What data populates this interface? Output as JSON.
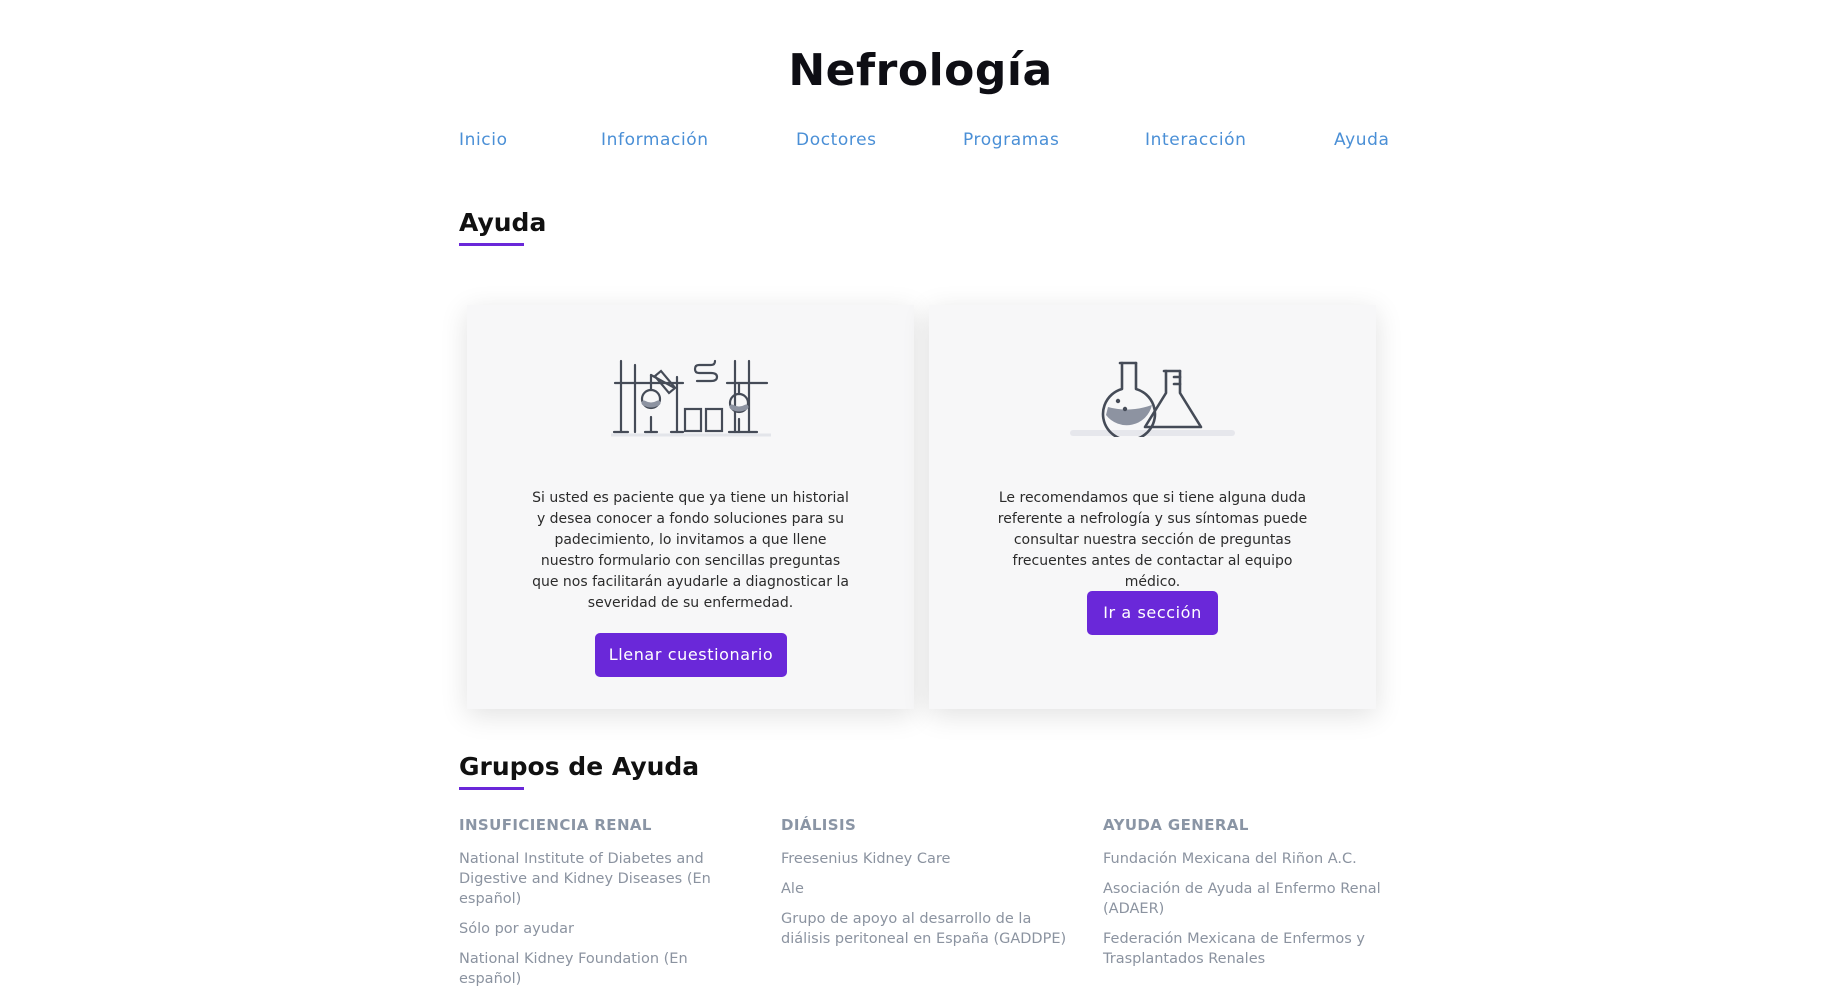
{
  "site": {
    "title": "Nefrología"
  },
  "nav": [
    "Inicio",
    "Información",
    "Doctores",
    "Programas",
    "Interacción",
    "Ayuda"
  ],
  "help": {
    "title": "Ayuda",
    "cards": [
      {
        "text": "Si usted es paciente que ya tiene un historial y desea conocer a fondo soluciones para su padecimiento, lo invitamos a que llene nuestro formulario con sencillas preguntas que nos facilitarán ayudarle a diagnosticar la severidad de su enfermedad.",
        "button": "Llenar cuestionario",
        "icon": "lab-equipment-icon"
      },
      {
        "text": "Le recomendamos que si tiene alguna duda referente a nefrología y sus síntomas puede consultar nuestra sección de preguntas frecuentes antes de contactar al equipo médico.",
        "button": "Ir a sección",
        "icon": "flasks-icon"
      }
    ]
  },
  "groups": {
    "title": "Grupos de Ayuda",
    "columns": [
      {
        "heading": "INSUFICIENCIA RENAL",
        "links": [
          "National Institute of Diabetes and Digestive and Kidney Diseases (En español)",
          "Sólo por ayudar",
          "National Kidney Foundation (En español)"
        ]
      },
      {
        "heading": "DIÁLISIS",
        "links": [
          "Freesenius Kidney Care",
          "Ale",
          "Grupo de apoyo al desarrollo de la diálisis peritoneal en España (GADDPE)"
        ]
      },
      {
        "heading": "AYUDA GENERAL",
        "links": [
          "Fundación Mexicana del Riñon A.C.",
          "Asociación de Ayuda al Enfermo Renal (ADAER)",
          "Federación Mexicana de Enfermos y Trasplantados Renales"
        ]
      }
    ]
  },
  "colors": {
    "accent": "#6a28d9",
    "nav_link": "#4a8fd6",
    "muted": "#8b93a0"
  }
}
